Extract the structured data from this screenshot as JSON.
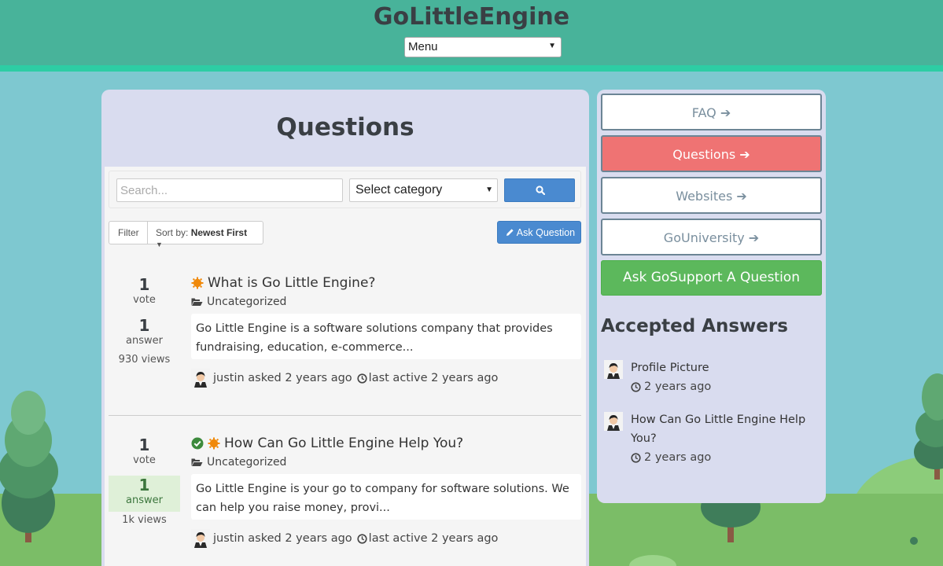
{
  "header": {
    "site_title": "GoLittleEngine",
    "menu_value": "Menu"
  },
  "main": {
    "page_title": "Questions",
    "search_placeholder": "Search...",
    "category_value": "Select category",
    "filter_label": "Filter",
    "sort_prefix": "Sort by:",
    "sort_value": "Newest First",
    "ask_label": "Ask Question",
    "questions": [
      {
        "votes": "1",
        "votes_label": "vote",
        "answers": "1",
        "answers_label": "answer",
        "views": "930 views",
        "title": "What is Go Little Engine?",
        "accepted": false,
        "category": "Uncategorized",
        "excerpt": "Go Little Engine is a software solutions company that provides fundraising, education, e-commerce...",
        "author": "justin",
        "asked": "asked 2 years ago",
        "last_active": "last active 2 years ago"
      },
      {
        "votes": "1",
        "votes_label": "vote",
        "answers": "1",
        "answers_label": "answer",
        "views": "1k views",
        "title": "How Can Go Little Engine Help You?",
        "accepted": true,
        "category": "Uncategorized",
        "excerpt": "Go Little Engine is your go to company for software solutions. We can help you raise money, provi...",
        "author": "justin",
        "asked": "asked 2 years ago",
        "last_active": "last active 2 years ago"
      }
    ]
  },
  "sidebar": {
    "links": [
      {
        "label": "FAQ",
        "active": false
      },
      {
        "label": "Questions",
        "active": true
      },
      {
        "label": "Websites",
        "active": false
      },
      {
        "label": "GoUniversity",
        "active": false
      }
    ],
    "ask_support_label": "Ask GoSupport A Question",
    "accepted_title": "Accepted Answers",
    "accepted": [
      {
        "title": "Profile Picture",
        "time": "2 years ago"
      },
      {
        "title": "How Can Go Little Engine Help You?",
        "time": "2 years ago"
      }
    ]
  },
  "colors": {
    "header_bg": "#48b39a",
    "header_stripe": "#2dcda4",
    "sky": "#7ec8d0",
    "grass": "#7bbd67",
    "panel": "#d9dcef",
    "primary": "#4a8ad0",
    "active_link": "#ef7373",
    "success": "#5cb85c"
  },
  "icons": [
    "search-icon",
    "pencil-icon",
    "sun-badge-icon",
    "check-circle-icon",
    "folder-open-icon",
    "clock-icon",
    "arrow-right-icon",
    "avatar-icon"
  ]
}
